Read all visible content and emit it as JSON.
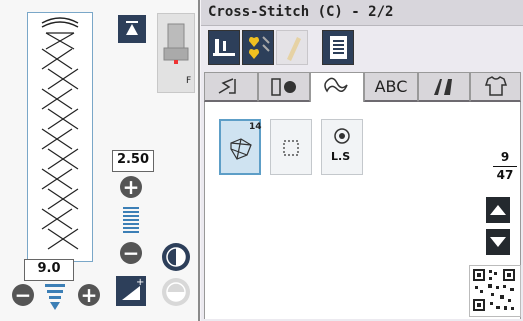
{
  "left": {
    "width_value": "2.50",
    "length_value": "9.0",
    "foot_label": "F"
  },
  "header": {
    "title": "Cross-Stitch (C) - 2/2"
  },
  "tabs": [
    {
      "label": "",
      "icon": "utility-stitch-icon"
    },
    {
      "label": "",
      "icon": "buttonhole-icon"
    },
    {
      "label": "",
      "icon": "decorative-stitch-icon",
      "active": true
    },
    {
      "label": "ABC",
      "icon": ""
    },
    {
      "label": "",
      "icon": "quilt-icon"
    },
    {
      "label": "",
      "icon": "shirt-icon"
    }
  ],
  "stitches": [
    {
      "number": "14",
      "icon": "cross-stitch-icon",
      "selected": true
    },
    {
      "number": "",
      "icon": "dotted-square-icon"
    },
    {
      "number": "",
      "label": "L.S",
      "icon": "locking-stitch-icon"
    }
  ],
  "page": {
    "current": "9",
    "total": "47"
  },
  "colors": {
    "accent": "#5d9ec7",
    "dark": "#24292e",
    "selected_bg": "#cfe3f1",
    "yellow": "#f0c020"
  }
}
